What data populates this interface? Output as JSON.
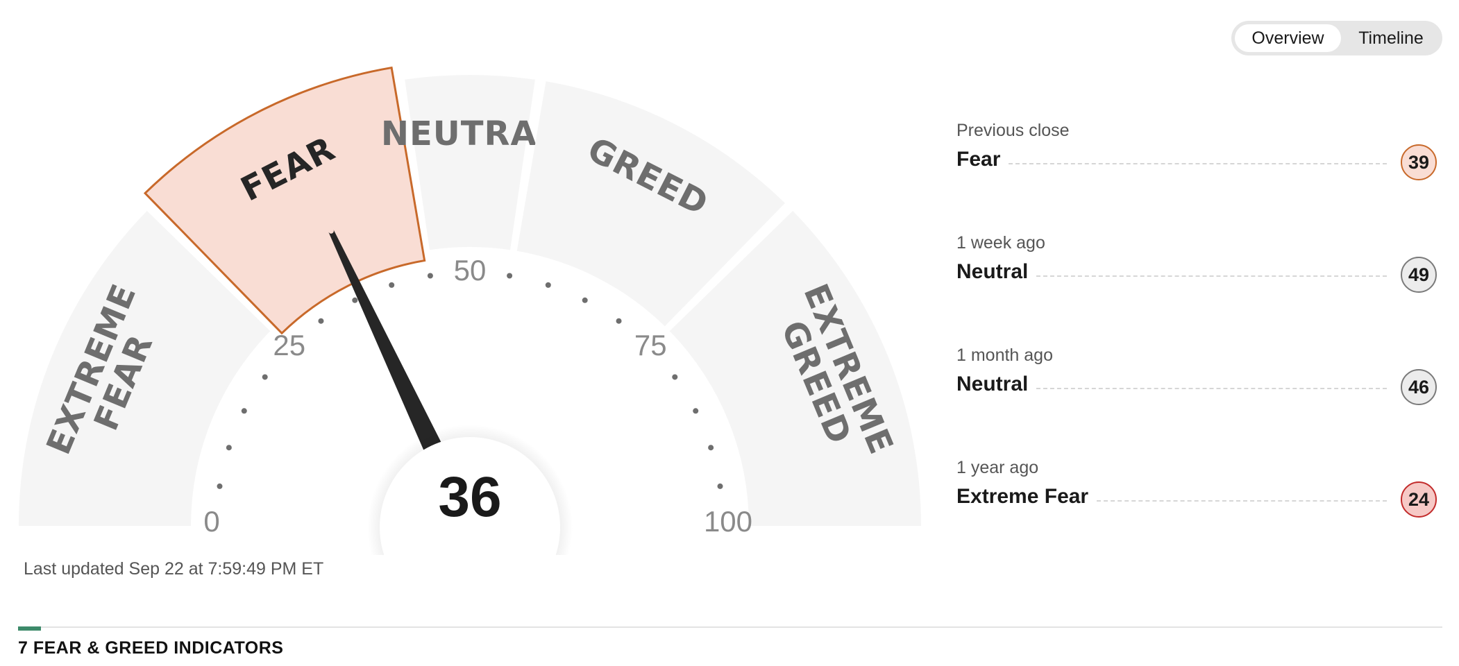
{
  "toggle": {
    "options": [
      {
        "label": "Overview",
        "active": true
      },
      {
        "label": "Timeline",
        "active": false
      }
    ]
  },
  "gauge": {
    "value": 36,
    "value_text": "36",
    "active_segment": "fear",
    "segments": [
      {
        "id": "extreme-fear",
        "lines": [
          "EXTREME",
          "FEAR"
        ],
        "from": 0,
        "to": 25
      },
      {
        "id": "fear",
        "lines": [
          "FEAR"
        ],
        "from": 25,
        "to": 45
      },
      {
        "id": "neutral",
        "lines": [
          "NEUTRAL"
        ],
        "from": 45,
        "to": 55
      },
      {
        "id": "greed",
        "lines": [
          "GREED"
        ],
        "from": 55,
        "to": 75
      },
      {
        "id": "extreme-greed",
        "lines": [
          "EXTREME",
          "GREED"
        ],
        "from": 75,
        "to": 100
      }
    ],
    "tick_labels": [
      {
        "value": 0,
        "text": "0"
      },
      {
        "value": 25,
        "text": "25"
      },
      {
        "value": 50,
        "text": "50"
      },
      {
        "value": 75,
        "text": "75"
      },
      {
        "value": 100,
        "text": "100"
      }
    ],
    "colors": {
      "segment_fill": "#f5f5f5",
      "active_fill": "#f9ddd4",
      "active_stroke": "#c8692a",
      "needle": "#262626",
      "dot": "#6e6e6e"
    }
  },
  "last_updated": "Last updated Sep 22 at 7:59:49 PM ET",
  "history": [
    {
      "when": "Previous close",
      "rating": "Fear",
      "value": "39",
      "badge_bg": "#f9ddd4",
      "badge_border": "#c8692a"
    },
    {
      "when": "1 week ago",
      "rating": "Neutral",
      "value": "49",
      "badge_bg": "#ececec",
      "badge_border": "#7a7a7a"
    },
    {
      "when": "1 month ago",
      "rating": "Neutral",
      "value": "46",
      "badge_bg": "#ececec",
      "badge_border": "#7a7a7a"
    },
    {
      "when": "1 year ago",
      "rating": "Extreme Fear",
      "value": "24",
      "badge_bg": "#f6c9c6",
      "badge_border": "#c22b2b"
    }
  ],
  "indicators_section": {
    "title": "7 FEAR & GREED INDICATORS",
    "accent_color": "#3d8a6a"
  }
}
